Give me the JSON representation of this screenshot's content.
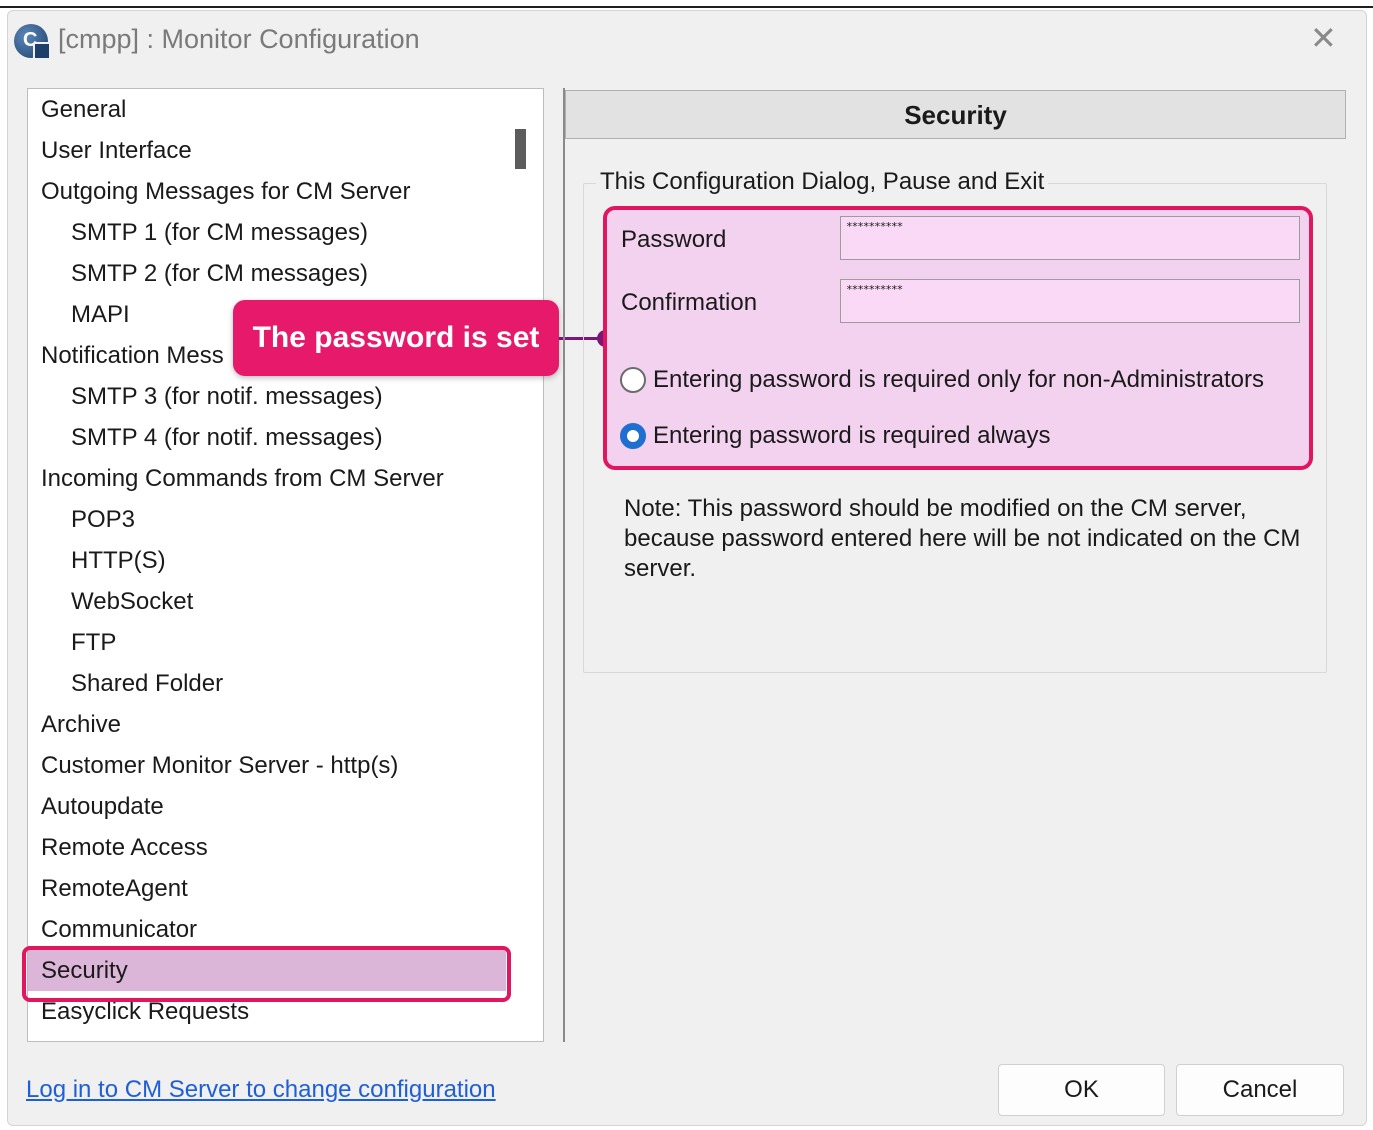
{
  "window": {
    "title": "[cmpp] : Monitor Configuration",
    "app_icon_letter": "C",
    "close_glyph": "✕"
  },
  "sidebar": {
    "items": [
      {
        "label": "General",
        "level": 1
      },
      {
        "label": "User Interface",
        "level": 1
      },
      {
        "label": "Outgoing Messages for CM Server",
        "level": 1
      },
      {
        "label": "SMTP 1 (for CM messages)",
        "level": 2
      },
      {
        "label": "SMTP 2 (for CM messages)",
        "level": 2
      },
      {
        "label": "MAPI",
        "level": 2
      },
      {
        "label": "Notification Mess",
        "level": 1
      },
      {
        "label": "SMTP 3 (for notif. messages)",
        "level": 2
      },
      {
        "label": "SMTP 4 (for notif. messages)",
        "level": 2
      },
      {
        "label": "Incoming Commands from CM Server",
        "level": 1
      },
      {
        "label": "POP3",
        "level": 2
      },
      {
        "label": "HTTP(S)",
        "level": 2
      },
      {
        "label": "WebSocket",
        "level": 2
      },
      {
        "label": "FTP",
        "level": 2
      },
      {
        "label": "Shared Folder",
        "level": 2
      },
      {
        "label": "Archive",
        "level": 1
      },
      {
        "label": "Customer Monitor Server - http(s)",
        "level": 1
      },
      {
        "label": "Autoupdate",
        "level": 1
      },
      {
        "label": "Remote Access",
        "level": 1
      },
      {
        "label": "RemoteAgent",
        "level": 1
      },
      {
        "label": "Communicator",
        "level": 1
      },
      {
        "label": "Security",
        "level": 1,
        "selected": true
      },
      {
        "label": "Easyclick Requests",
        "level": 1
      }
    ]
  },
  "callout": {
    "text": "The password is set",
    "color": "#e6196b"
  },
  "panel": {
    "header": "Security",
    "group_title": "This Configuration Dialog, Pause and Exit",
    "password_label": "Password",
    "password_value": "**********",
    "confirmation_label": "Confirmation",
    "confirmation_value": "**********",
    "radio_options": [
      {
        "label": "Entering password is required only for non-Administrators",
        "checked": false
      },
      {
        "label": "Entering password is required always",
        "checked": true
      }
    ],
    "note": "Note: This password should be modified on the CM server, because password entered here will be not indicated  on the CM server."
  },
  "footer": {
    "login_link": "Log in to CM Server to change configuration",
    "ok_label": "OK",
    "cancel_label": "Cancel"
  },
  "colors": {
    "highlight_border": "#e0165e",
    "highlight_fill": "#f3d2f0",
    "selected_item": "#dcb6d8",
    "link": "#1f5fd6",
    "radio_accent": "#1f6fd0"
  }
}
